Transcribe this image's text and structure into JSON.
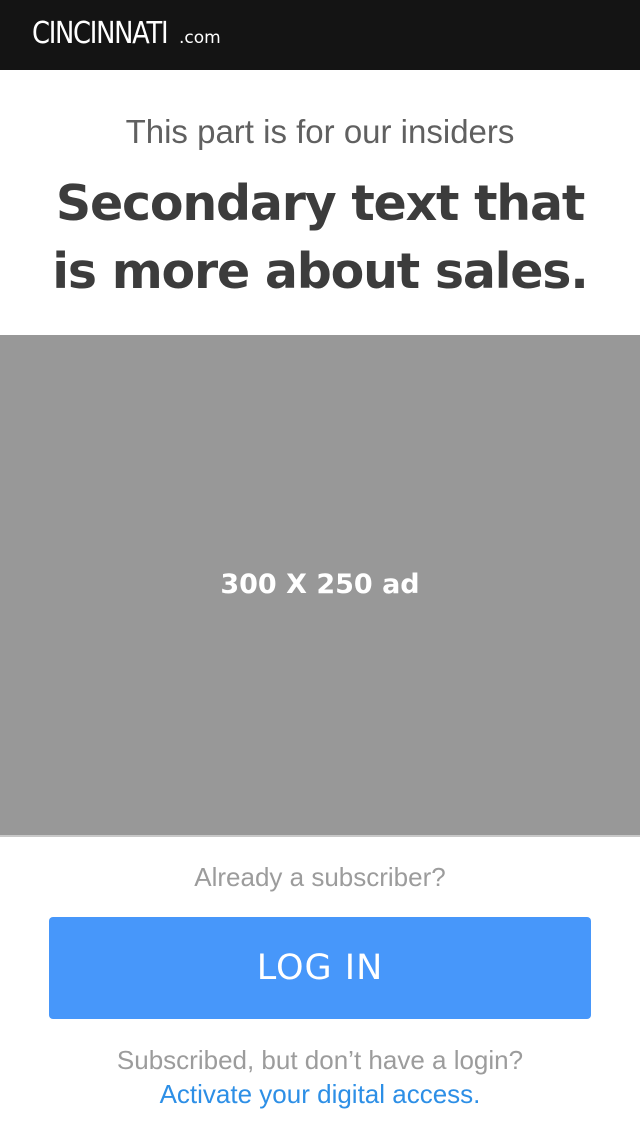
{
  "header": {
    "logo_main": "CINCINNATI",
    "logo_domain": ".com"
  },
  "paywall": {
    "intro": "This part is for our insiders",
    "headline": "Secondary text that is more about sales."
  },
  "ad": {
    "label": "300 X 250 ad"
  },
  "login": {
    "prompt": "Already a subscriber?",
    "button_label": "LOG IN"
  },
  "activation": {
    "prompt": "Subscribed, but don’t have a login?",
    "link_label": "Activate your digital access."
  },
  "colors": {
    "header_bg": "#141414",
    "button_blue": "#4797fa",
    "link_blue": "#2d8fe6",
    "ad_gray": "#989898"
  }
}
